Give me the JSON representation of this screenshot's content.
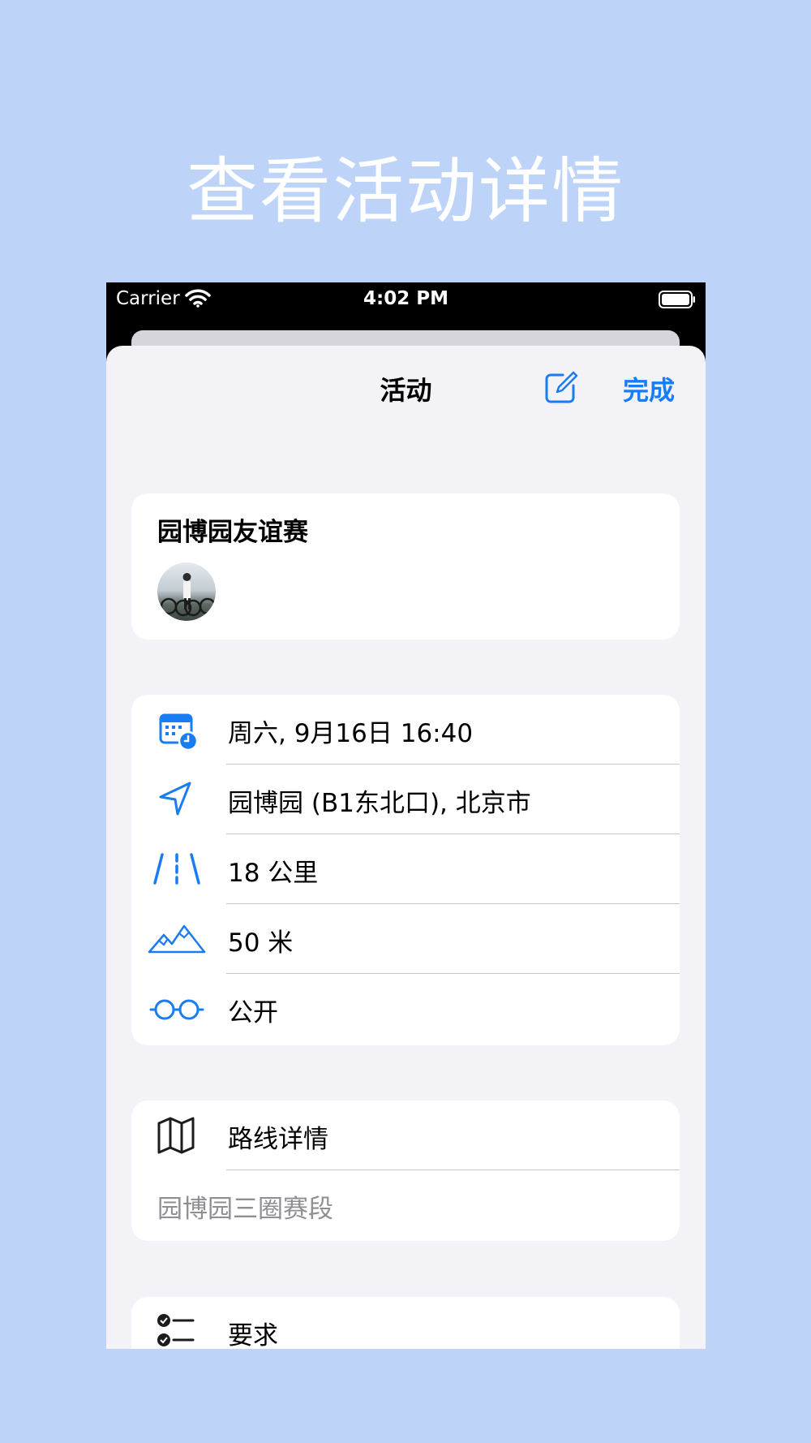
{
  "headline": "查看活动详情",
  "status_bar": {
    "carrier": "Carrier",
    "time": "4:02 PM"
  },
  "nav": {
    "title": "活动",
    "done": "完成"
  },
  "activity": {
    "name": "园博园友谊赛"
  },
  "details": [
    {
      "icon": "calendar-clock-icon",
      "text": "周六, 9月16日 16:40"
    },
    {
      "icon": "location-arrow-icon",
      "text": "园博园 (B1东北口), 北京市"
    },
    {
      "icon": "road-icon",
      "text": "18 公里"
    },
    {
      "icon": "mountains-icon",
      "text": "50 米"
    },
    {
      "icon": "glasses-icon",
      "text": "公开"
    }
  ],
  "route": {
    "icon": "map-icon",
    "label": "路线详情",
    "name": "园博园三圈赛段"
  },
  "requirements": {
    "icon": "checklist-icon",
    "label": "要求"
  },
  "colors": {
    "accent": "#1a7cf2",
    "background": "#bdd4f8",
    "sheet": "#f2f2f7"
  }
}
